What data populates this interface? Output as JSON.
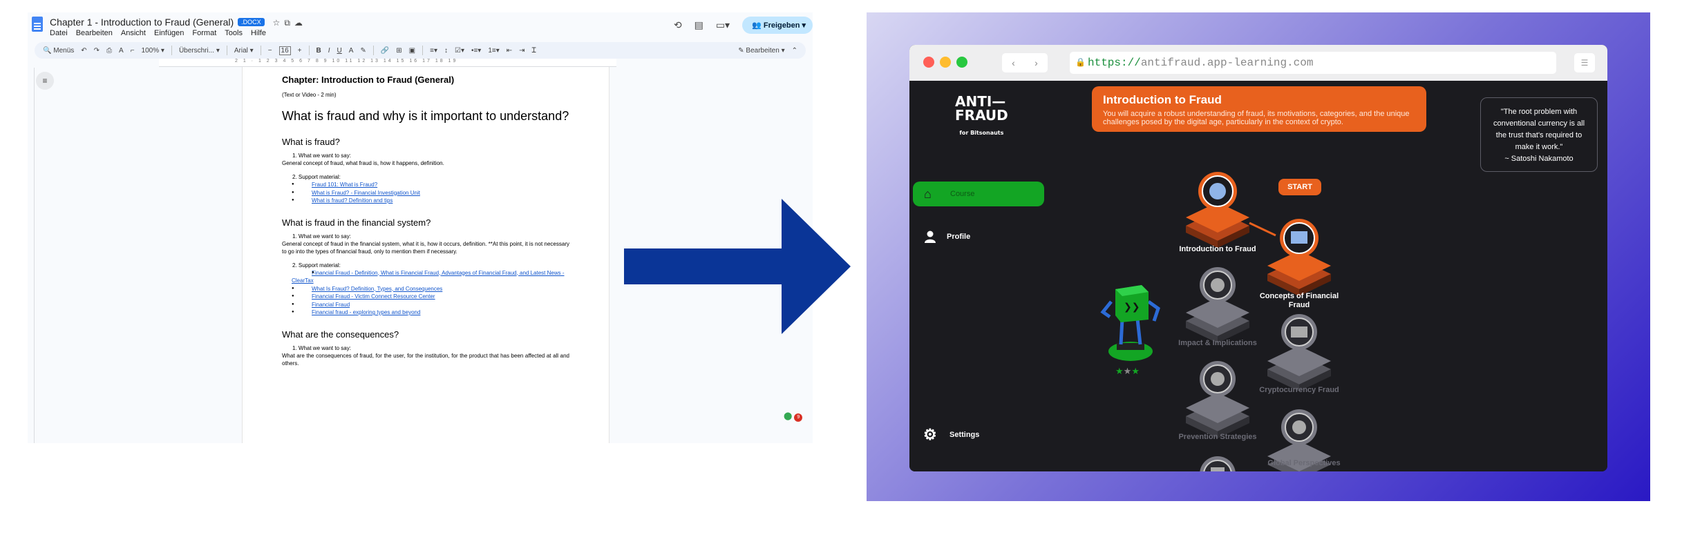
{
  "docs": {
    "title": "Chapter 1 - Introduction to Fraud (General)",
    "badge": ".DOCX",
    "menu": [
      "Datei",
      "Bearbeiten",
      "Ansicht",
      "Einfügen",
      "Format",
      "Tools",
      "Hilfe"
    ],
    "share_label": "Freigeben",
    "toolbar": {
      "menus_search": "Menüs",
      "zoom": "100%",
      "style": "Überschri...",
      "font": "Arial",
      "font_size": "16",
      "edit_mode": "Bearbeiten"
    },
    "doc": {
      "chapter_title": "Chapter: Introduction to Fraud (General)",
      "format_note": "(Text or Video - 2 min)",
      "main_heading": "What is fraud and why is it important to understand?",
      "sections": [
        {
          "heading": "What is fraud?",
          "say_label": "1.   What we want to say:",
          "say_text": "General concept of fraud, what fraud is, how it happens, definition.",
          "support_label": "2.   Support material:",
          "links": [
            "Fraud 101: What is Fraud?",
            "What is Fraud? - Financial Investigation Unit",
            "What is fraud? Definition and tips"
          ]
        },
        {
          "heading": "What is fraud in the financial system?",
          "say_label": "1.   What we want to say:",
          "say_text": "General concept of fraud in the financial system, what it is, how it occurs, definition. **At this point, it is not necessary to go into the types of financial fraud, only to mention them if necessary.",
          "support_label": "2.   Support material:",
          "links": [
            "Financial Fraud - Definition, What is Financial Fraud, Advantages of Financial Fraud, and Latest News - ClearTax",
            "What Is Fraud? Definition, Types, and Consequences",
            "Financial Fraud - Victim Connect Resource Center",
            "Financial Fraud",
            "Financial fraud - exploring types and beyond"
          ]
        },
        {
          "heading": "What are the consequences?",
          "say_label": "1.   What we want to say:",
          "say_text": "What are the consequences of fraud, for the user, for the institution, for the product that has been affected at all and others."
        }
      ]
    }
  },
  "browser": {
    "url_scheme": "https://",
    "url_host": "antifraud.app-learning.com"
  },
  "app": {
    "logo_line1": "ANTI—",
    "logo_line2": "FRAUD",
    "logo_sub": "for Bitsonauts",
    "nav": {
      "course": "Course",
      "profile": "Profile",
      "settings": "Settings"
    },
    "banner_title": "Introduction to Fraud",
    "banner_desc": "You will acquire a robust understanding of fraud, its motivations, categories, and the unique challenges posed by the digital age, particularly in the context of crypto.",
    "quote_text": "\"The root problem with conventional currency is all the trust that's required to make it work.\"",
    "quote_author": "~ Satoshi Nakamoto",
    "start_label": "START",
    "modules": [
      "Introduction to Fraud",
      "Concepts of Financial Fraud",
      "Impact & Implications",
      "Cryptocurrency Fraud",
      "Prevention Strategies",
      "Global Perspectives"
    ],
    "stars": "★★★",
    "colors": {
      "accent": "#e8611e",
      "nav_active": "#13a524",
      "background": "#1b1b1f",
      "arrow": "#0a3597"
    }
  }
}
